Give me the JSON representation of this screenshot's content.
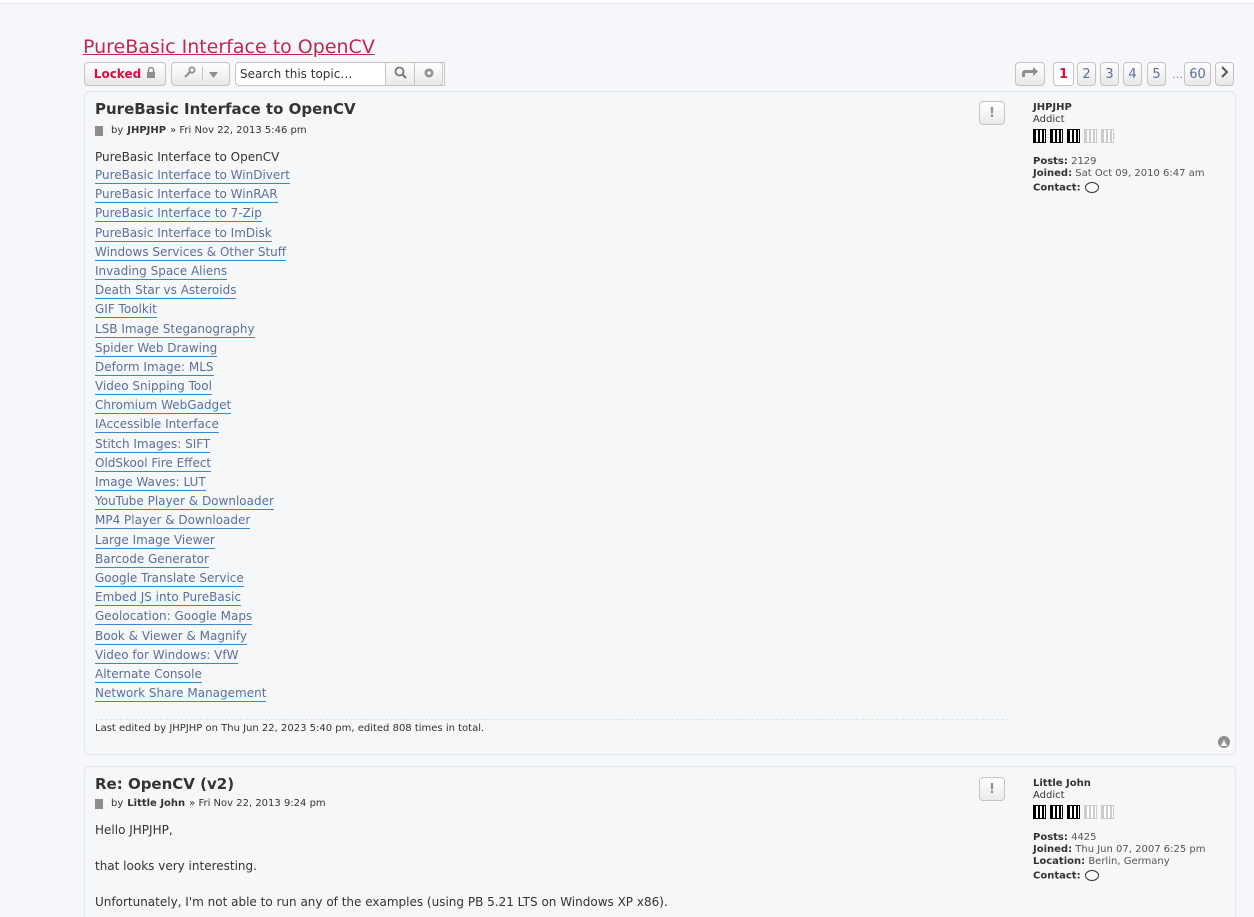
{
  "topic": {
    "title": "PureBasic Interface to OpenCV"
  },
  "action_bar": {
    "locked_label": "Locked",
    "search_placeholder": "Search this topic…"
  },
  "pagination": {
    "pages": [
      "1",
      "2",
      "3",
      "4",
      "5"
    ],
    "ellipsis": "…",
    "last": "60",
    "current": "1"
  },
  "posts": [
    {
      "title": "PureBasic Interface to OpenCV",
      "by": "by",
      "author": "JHPJHP",
      "date": "» Fri Nov 22, 2013 5:46 pm",
      "heading": "PureBasic Interface to OpenCV",
      "links": [
        "PureBasic Interface to WinDivert",
        "PureBasic Interface to WinRAR",
        "PureBasic Interface to 7-Zip",
        "PureBasic Interface to ImDisk",
        "Windows Services & Other Stuff",
        "Invading Space Aliens",
        "Death Star vs Asteroids",
        "GIF Toolkit",
        "LSB Image Steganography",
        "Spider Web Drawing",
        "Deform Image: MLS",
        "Video Snipping Tool",
        "Chromium WebGadget",
        "IAccessible Interface",
        "Stitch Images: SIFT",
        "OldSkool Fire Effect",
        "Image Waves: LUT",
        "YouTube Player & Downloader",
        "MP4 Player & Downloader",
        "Large Image Viewer",
        "Barcode Generator",
        "Google Translate Service",
        "Embed JS into PureBasic",
        "Geolocation: Google Maps",
        "Book & Viewer & Magnify",
        "Video for Windows: VfW",
        "Alternate Console",
        "Network Share Management"
      ],
      "edit_notice": "Last edited by JHPJHP on Thu Jun 22, 2023 5:40 pm, edited 808 times in total.",
      "profile": {
        "username": "JHPJHP",
        "rank": "Addict",
        "posts_label": "Posts:",
        "posts_value": "2129",
        "joined_label": "Joined:",
        "joined_value": "Sat Oct 09, 2010 6:47 am",
        "contact_label": "Contact:"
      }
    },
    {
      "title": "Re: OpenCV (v2)",
      "by": "by",
      "author": "Little John",
      "date": "» Fri Nov 22, 2013 9:24 pm",
      "lines": [
        "Hello JHPJHP,",
        "that looks very interesting.",
        "Unfortunately, I'm not able to run any of the examples (using PB 5.21 LTS on Windows XP x86)."
      ],
      "profile": {
        "username": "Little John",
        "rank": "Addict",
        "posts_label": "Posts:",
        "posts_value": "4425",
        "joined_label": "Joined:",
        "joined_value": "Thu Jun 07, 2007 6:25 pm",
        "location_label": "Location:",
        "location_value": "Berlin, Germany",
        "contact_label": "Contact:"
      }
    }
  ]
}
